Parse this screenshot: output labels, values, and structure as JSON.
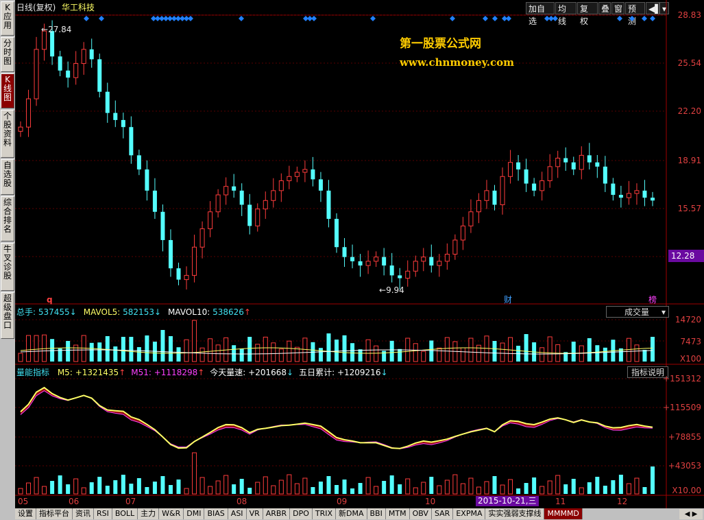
{
  "sidebar": [
    {
      "label": "K\n应\n用",
      "active": false
    },
    {
      "label": "分\n时\n图",
      "active": false
    },
    {
      "label": "K\n线\n图",
      "active": true
    },
    {
      "label": "个\n股\n资\n料",
      "active": false
    },
    {
      "label": "自\n选\n股",
      "active": false
    },
    {
      "label": "综\n合\n排\n名",
      "active": false
    },
    {
      "label": "牛\n叉\n诊\n股",
      "active": false
    },
    {
      "label": "超\n级\n盘\n口",
      "active": false
    }
  ],
  "header": {
    "period": "日线(复权)",
    "stock_name": "华工科技"
  },
  "toolbar": [
    "加自选",
    "均线",
    "复权",
    "叠",
    "窗",
    "预测"
  ],
  "watermark": {
    "title": "第一股票公式网",
    "url": "www.chnmoney.com"
  },
  "price_axis": [
    "28.83",
    "25.54",
    "22.20",
    "18.91",
    "15.57"
  ],
  "current_price": "12.28",
  "price_annotations": {
    "high": "27.84",
    "low": "9.94"
  },
  "event_markers": {
    "q": "q",
    "cai": "财",
    "bang": "榜"
  },
  "volume_panel": {
    "labels": [
      {
        "name": "总手:",
        "value": "537455",
        "arrow": "↓",
        "name_color": "#40e0f0"
      },
      {
        "name": "MAVOL5:",
        "value": "582153",
        "arrow": "↓",
        "name_color": "#ffff66"
      },
      {
        "name": "MAVOL10:",
        "value": "538626",
        "arrow": "↑",
        "name_color": "#ffffff"
      }
    ],
    "dropdown": "成交量",
    "axis": [
      "14720",
      "7473",
      "X100"
    ]
  },
  "indicator_panel": {
    "labels": [
      {
        "name": "量能指标",
        "value": "",
        "arrow": "",
        "color": "#40e0f0"
      },
      {
        "name": "M5:",
        "value": "+1321435",
        "arrow": "↑",
        "color": "#ffff66"
      },
      {
        "name": "M51:",
        "value": "+1118298",
        "arrow": "↑",
        "color": "#ff40ff"
      },
      {
        "name": "今天量速:",
        "value": "+201668",
        "arrow": "↓",
        "color": "#ffffff"
      },
      {
        "name": "五日累计:",
        "value": "+1209216",
        "arrow": "↓",
        "color": "#ffffff"
      }
    ],
    "button": "指标说明",
    "axis": [
      "+151312",
      "+115509",
      "+78855",
      "+43053",
      "X10.00"
    ]
  },
  "x_axis": {
    "labels": [
      "05",
      "06",
      "07",
      "08",
      "09",
      "10",
      "11",
      "12"
    ],
    "cursor_date": "2015-10-21,三"
  },
  "bottom_tabs": [
    "设置",
    "指标平台",
    "资讯",
    "RSI",
    "BOLL",
    "主力",
    "W&R",
    "DMI",
    "BIAS",
    "ASI",
    "VR",
    "ARBR",
    "DPO",
    "TRIX",
    "新DMA",
    "BBI",
    "MTM",
    "OBV",
    "SAR",
    "EXPMA",
    "实实强弱支撑线",
    "MMMMD"
  ],
  "chart_data": {
    "type": "candlestick",
    "x_labels": [
      "05",
      "06",
      "07",
      "08",
      "09",
      "10",
      "11",
      "12"
    ],
    "ylim": [
      9.5,
      28.83
    ],
    "close_series": [
      21,
      23,
      26.5,
      27.8,
      26,
      25,
      24.5,
      25.5,
      26.5,
      25.8,
      23.5,
      22,
      21.5,
      21,
      19,
      18,
      16.5,
      15,
      13,
      11,
      10.2,
      10.5,
      12.5,
      13.8,
      15,
      16.2,
      16.8,
      16.5,
      15.5,
      14,
      15.2,
      15.8,
      16.5,
      17.2,
      17.5,
      17.8,
      18,
      17.3,
      16.5,
      14.5,
      12.5,
      11.8,
      11.5,
      11.2,
      11.5,
      11.8,
      11.2,
      10.5,
      10.3,
      10.8,
      11.5,
      11.8,
      11.2,
      11.5,
      12,
      13,
      14,
      15,
      15.8,
      16.5,
      15.5,
      17.5,
      18.5,
      18,
      17,
      16.5,
      17.2,
      18.2,
      18.8,
      18.5,
      18,
      19,
      18.5,
      18.2,
      17,
      16.2,
      16,
      16.3,
      16.5,
      16,
      15.8
    ]
  }
}
